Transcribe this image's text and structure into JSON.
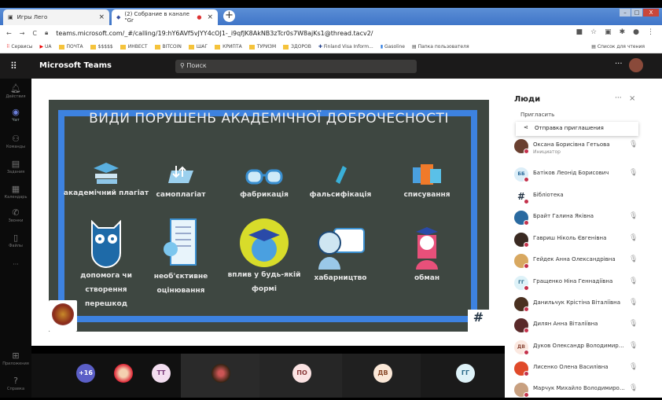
{
  "browser": {
    "tabs": [
      {
        "title": "Игры Лего",
        "close": "×"
      },
      {
        "title": "(2) Собрание в канале \"Gr",
        "close": "×"
      }
    ],
    "new_tab": "+",
    "window_buttons": [
      "–",
      "□",
      "X"
    ],
    "nav": [
      "←",
      "→",
      "C"
    ],
    "url": "teams.microsoft.com/_#/calling/19:hY6AVf5vJYY4cOJ1-_i9qfJK8AkNB3zTcr0s7W8ajKs1@thread.tacv2/",
    "bookmarks": [
      "Сервисы",
      "UA",
      "ПОЧТА",
      "$$$$$",
      "ИНВЕСТ",
      "BITCOIN",
      "ШАГ",
      "КРИПТА",
      "ТУРИЗМ",
      "ЗДОРОВ",
      "Finland Visa Inform...",
      "Gasoline",
      "Папка пользователя"
    ],
    "reading_list": "Список для чтения"
  },
  "teams": {
    "app_title": "Microsoft Teams",
    "search_placeholder": "Поиск",
    "more": "···"
  },
  "rail": [
    "Действия",
    "Чат",
    "Команды",
    "Задания",
    "Календарь",
    "Звонки",
    "Файлы",
    "···",
    "Приложения",
    "Справка"
  ],
  "slide": {
    "title": "ВИДИ ПОРУШЕНЬ АКАДЕМІЧНОЇ ДОБРОЧЕСНОСТІ",
    "items": [
      "академічний плагіат",
      "самоплагіат",
      "фабрикація",
      "фальсифікація",
      "списування",
      "допомога чи створення перешкод",
      "необ'єктивне оцінювання",
      "вплив у будь-якій формі",
      "хабарництво",
      "обман"
    ],
    "logo_right": "#"
  },
  "strip": {
    "overflow": "+16",
    "avatars": [
      "ТТ",
      "ПО",
      "ДВ",
      "ГГ"
    ]
  },
  "panel": {
    "title": "Люди",
    "more": "···",
    "close": "×",
    "invite_label": "Пригласить",
    "tooltip": "Отправка приглашения",
    "people": [
      {
        "name": "Оксана Борисівна Гетьова",
        "role": "Инициатор",
        "initials": ""
      },
      {
        "name": "Батіков Леонід Борисович",
        "initials": "ББ"
      },
      {
        "name": "Бібліотека",
        "initials": "#"
      },
      {
        "name": "Брайт Галина Яківна",
        "initials": ""
      },
      {
        "name": "Гавриш Ніколь Євгенівна",
        "initials": ""
      },
      {
        "name": "Гейдек Анна Олександрівна",
        "initials": ""
      },
      {
        "name": "Гращенко Ніна Геннадіївна",
        "initials": "ГГ"
      },
      {
        "name": "Данильчук Крістіна Віталіївна",
        "initials": ""
      },
      {
        "name": "Дилян Анна Віталіївна",
        "initials": ""
      },
      {
        "name": "Дуков Олександр Володимирович",
        "initials": "ДВ"
      },
      {
        "name": "Лисенко Олена Василівна",
        "initials": ""
      },
      {
        "name": "Марчук Михайло Володимирович",
        "initials": ""
      }
    ]
  }
}
